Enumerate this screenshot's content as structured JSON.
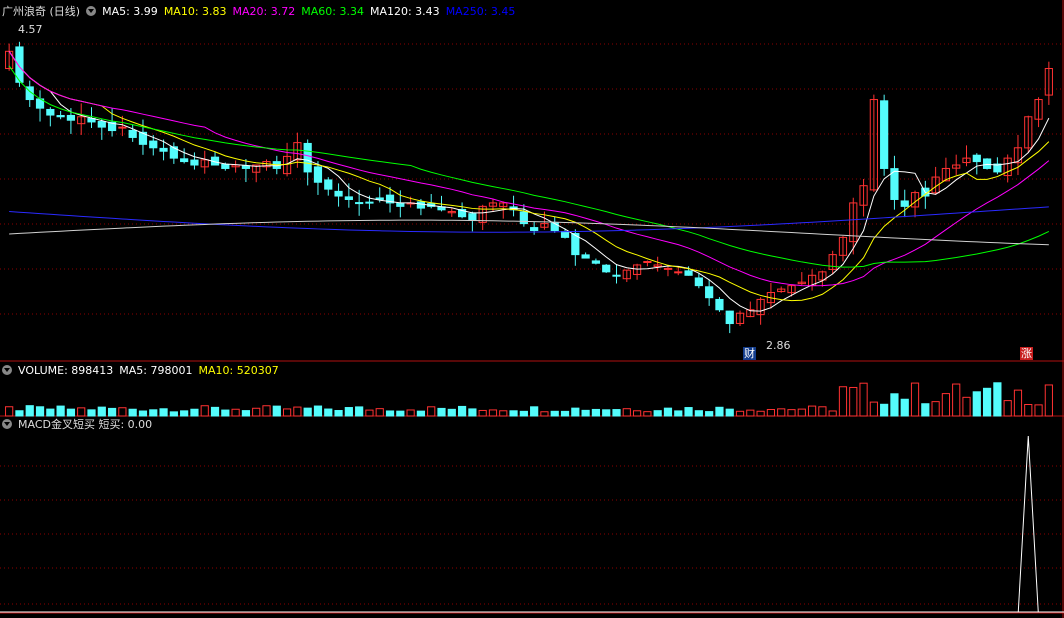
{
  "main_legend": {
    "title": "广州浪奇 (日线)",
    "ma": [
      {
        "label": "MA5: 3.99",
        "color": "#ffffff"
      },
      {
        "label": "MA10: 3.83",
        "color": "#ffff00"
      },
      {
        "label": "MA20: 3.72",
        "color": "#ff00ff"
      },
      {
        "label": "MA60: 3.34",
        "color": "#00ff00"
      },
      {
        "label": "MA120: 3.43",
        "color": "#ffffff"
      },
      {
        "label": "MA250: 3.45",
        "color": "#0000ff"
      }
    ]
  },
  "volume_legend": [
    {
      "label": "VOLUME: 898413",
      "color": "#ffffff"
    },
    {
      "label": "MA5: 798001",
      "color": "#ffffff"
    },
    {
      "label": "MA10: 520307",
      "color": "#ffff00"
    }
  ],
  "macd_legend": {
    "label": "MACD金叉短买  短买: 0.00",
    "color": "#ffffff"
  },
  "annotations": {
    "high_label": "4.57",
    "low_label": "2.86",
    "cai_badge": "财",
    "zhang_badge": "涨"
  },
  "colors": {
    "up": "#ff3232",
    "down": "#54fcfc",
    "grid": "#8b0000",
    "ma5": "#ffffff",
    "ma10": "#ffff00",
    "ma20": "#ff00ff",
    "ma60": "#00ff00",
    "ma120": "#d0d0d0",
    "ma250": "#2a2aff"
  },
  "chart_data": {
    "type": "candlestick",
    "price_range": [
      2.7,
      4.65
    ],
    "closes": [
      4.48,
      4.3,
      4.2,
      4.15,
      4.11,
      4.1,
      4.08,
      4.1,
      4.07,
      4.04,
      4.02,
      4.04,
      3.98,
      3.94,
      3.92,
      3.9,
      3.86,
      3.84,
      3.82,
      3.85,
      3.82,
      3.8,
      3.82,
      3.8,
      3.82,
      3.84,
      3.8,
      3.87,
      3.95,
      3.78,
      3.72,
      3.68,
      3.64,
      3.62,
      3.6,
      3.6,
      3.62,
      3.6,
      3.58,
      3.6,
      3.57,
      3.58,
      3.56,
      3.55,
      3.52,
      3.5,
      3.58,
      3.6,
      3.6,
      3.56,
      3.48,
      3.44,
      3.48,
      3.44,
      3.4,
      3.3,
      3.28,
      3.25,
      3.2,
      3.18,
      3.21,
      3.24,
      3.26,
      3.24,
      3.22,
      3.2,
      3.18,
      3.12,
      3.05,
      2.98,
      2.9,
      2.96,
      2.98,
      3.04,
      3.08,
      3.1,
      3.12,
      3.14,
      3.18,
      3.2,
      3.3,
      3.4,
      3.6,
      3.7,
      4.2,
      3.8,
      3.62,
      3.58,
      3.66,
      3.64,
      3.75,
      3.8,
      3.82,
      3.86,
      3.84,
      3.8,
      3.78,
      3.86,
      3.92,
      4.1,
      4.2,
      4.38
    ],
    "volume_range": [
      0,
      1100000
    ],
    "volume_ma_values": {
      "volume": 898413,
      "ma5": 798001,
      "ma10": 520307
    },
    "macd_signal": {
      "label": "短买",
      "value": 0.0
    }
  }
}
